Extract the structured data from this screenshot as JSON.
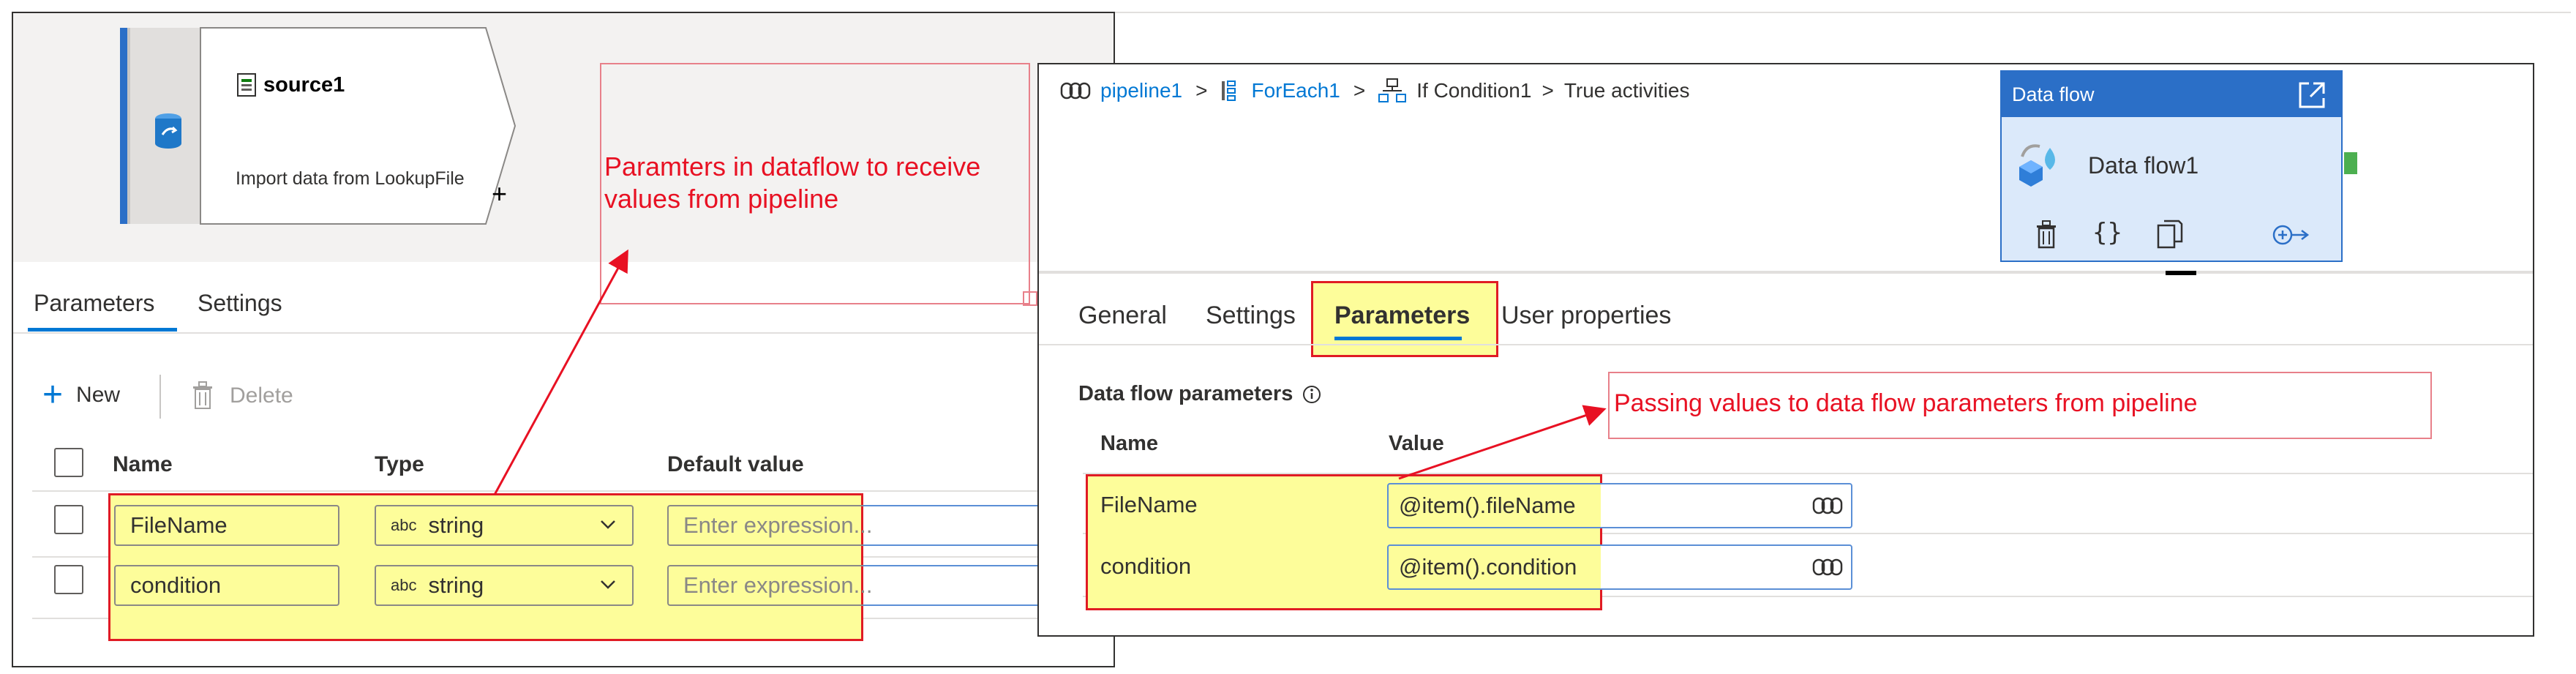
{
  "left": {
    "node": {
      "title": "source1",
      "subtitle": "Import data from LookupFile"
    },
    "tabs": [
      {
        "label": "Parameters"
      },
      {
        "label": "Settings"
      }
    ],
    "toolbar": {
      "new_label": "New",
      "delete_label": "Delete"
    },
    "table": {
      "columns": [
        "Name",
        "Type",
        "Default value"
      ],
      "rows": [
        {
          "name": "FileName",
          "type_tag": "abc",
          "type": "string",
          "default_placeholder": "Enter expression..."
        },
        {
          "name": "condition",
          "type_tag": "abc",
          "type": "string",
          "default_placeholder": "Enter expression..."
        }
      ]
    },
    "annotation": "Paramters in dataflow to receive values from pipeline"
  },
  "right": {
    "breadcrumb": {
      "pipeline": "pipeline1",
      "foreach": "ForEach1",
      "ifcond": "If Condition1",
      "tail": "True activities"
    },
    "card": {
      "header": "Data flow",
      "name": "Data flow1"
    },
    "tabs": [
      {
        "label": "General"
      },
      {
        "label": "Settings"
      },
      {
        "label": "Parameters"
      },
      {
        "label": "User properties"
      }
    ],
    "section_title": "Data flow parameters",
    "table": {
      "columns": [
        "Name",
        "Value"
      ],
      "rows": [
        {
          "name": "FileName",
          "value": "@item().fileName"
        },
        {
          "name": "condition",
          "value": "@item().condition"
        }
      ]
    },
    "annotation": "Passing values to data flow parameters from pipeline"
  },
  "colors": {
    "accent": "#0078d4",
    "annotation_red": "#e81123",
    "highlight": "#fdfd9a",
    "card_header": "#2b6fc7"
  },
  "icons": [
    "database-icon",
    "file-icon",
    "plus-icon",
    "trash-icon",
    "chevron-down-icon",
    "info-icon",
    "expression-icon",
    "pipeline-icon",
    "foreach-icon",
    "if-condition-icon",
    "external-link-icon",
    "dataflow-icon",
    "braces-icon",
    "copy-icon",
    "output-icon"
  ]
}
